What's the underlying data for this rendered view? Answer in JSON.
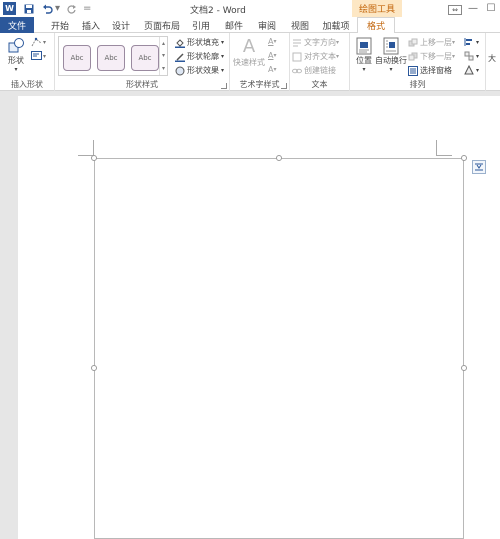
{
  "titlebar": {
    "title": "文档2 - Word",
    "context_tool": "绘图工具",
    "word_logo": "W",
    "icons": [
      "save-icon",
      "undo-icon",
      "redo-icon",
      "customize-icon"
    ]
  },
  "tabs": [
    {
      "label": "文件"
    },
    {
      "label": "开始"
    },
    {
      "label": "插入"
    },
    {
      "label": "设计"
    },
    {
      "label": "页面布局"
    },
    {
      "label": "引用"
    },
    {
      "label": "邮件"
    },
    {
      "label": "审阅"
    },
    {
      "label": "视图"
    },
    {
      "label": "加载项"
    },
    {
      "label": "格式"
    }
  ],
  "ribbon": {
    "insert_shapes": {
      "label": "插入形状",
      "shapes_button": "形状"
    },
    "shape_styles": {
      "label": "形状样式",
      "swatches": [
        "Abc",
        "Abc",
        "Abc"
      ],
      "fill": "形状填充",
      "outline": "形状轮廓",
      "effects": "形状效果"
    },
    "wordart": {
      "label": "艺术字样式",
      "quick_styles": "快速样式"
    },
    "text": {
      "label": "文本",
      "direction": "文字方向",
      "align": "对齐文本",
      "link": "创建链接"
    },
    "arrange": {
      "label": "排列",
      "position": "位置",
      "wrap": "自动换行",
      "bring_forward": "上移一层",
      "send_backward": "下移一层",
      "selection_pane": "选择窗格"
    },
    "size": {
      "label": "大"
    }
  },
  "colors": {
    "accent": "#2b579a",
    "context": "#c2650b",
    "context_bg": "#fde7c4"
  }
}
